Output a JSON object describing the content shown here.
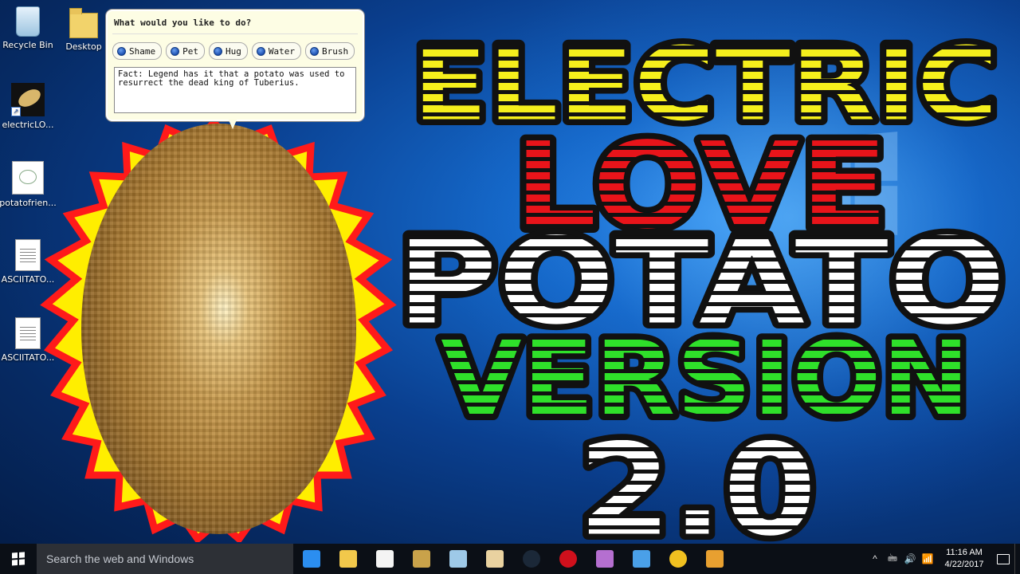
{
  "desktop": {
    "icons": [
      {
        "label": "Recycle Bin",
        "icon": "recycle-bin-icon"
      },
      {
        "label": "Desktop",
        "icon": "folder-icon"
      },
      {
        "label": "electricLO...",
        "icon": "potato-shortcut-icon"
      },
      {
        "label": "potatofrien...",
        "icon": "image-file-icon"
      },
      {
        "label": "ASCIITATO...",
        "icon": "text-file-icon"
      },
      {
        "label": "ASCIITATO...",
        "icon": "text-file-icon"
      }
    ]
  },
  "bubble": {
    "question": "What would you like to do?",
    "actions": [
      "Shame",
      "Pet",
      "Hug",
      "Water",
      "Brush"
    ],
    "fact": "Fact: Legend has it that a potato was used to resurrect the dead king of Tuberius."
  },
  "title": {
    "line1": "ELECTRIC",
    "line2": "LOVE",
    "line3": "POTATO",
    "line4": "VERSION",
    "line5": "2.0",
    "colors": {
      "line1": "#f5ef1c",
      "line2": "#e8141a",
      "line3": "#ffffff",
      "line4": "#2fe02a",
      "line5": "#ffffff"
    }
  },
  "taskbar": {
    "search_placeholder": "Search the web and Windows",
    "apps": [
      {
        "icon": "edge-icon",
        "color": "#2b8ef0"
      },
      {
        "icon": "file-explorer-icon",
        "color": "#f2c84b"
      },
      {
        "icon": "store-icon",
        "color": "#f4f4f4"
      },
      {
        "icon": "app-99-icon",
        "color": "#c9a24a"
      },
      {
        "icon": "notepad-app-icon",
        "color": "#9ec9e8"
      },
      {
        "icon": "paint-icon",
        "color": "#e9d2a0"
      },
      {
        "icon": "steam-icon",
        "color": "#1b2838"
      },
      {
        "icon": "record-icon",
        "color": "#d0101c"
      },
      {
        "icon": "potato-app-icon",
        "color": "#b56fd0"
      },
      {
        "icon": "pen-app-icon",
        "color": "#4aa0e8"
      },
      {
        "icon": "chrome-icon",
        "color": "#f0c020"
      },
      {
        "icon": "potato-running-icon",
        "color": "#e8a030"
      }
    ],
    "tray": {
      "chevron": "^",
      "ime": "🖮",
      "volume": "🔊",
      "network": "📶",
      "time": "11:16 AM",
      "date": "4/22/2017"
    }
  }
}
